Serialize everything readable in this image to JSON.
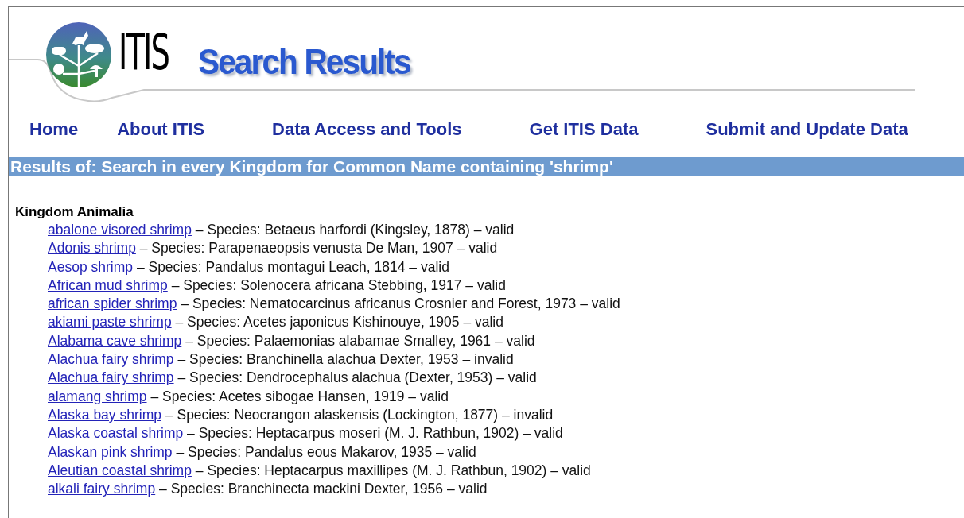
{
  "header": {
    "logo_text": "ITIS",
    "title": "Search Results"
  },
  "nav": [
    "Home",
    "About ITIS",
    "Data Access and Tools",
    "Get ITIS Data",
    "Submit and Update Data"
  ],
  "banner": "Results of: Search in every Kingdom for Common Name containing 'shrimp'",
  "kingdom": "Kingdom Animalia",
  "results": [
    {
      "name": "abalone visored shrimp",
      "detail": "– Species: Betaeus harfordi (Kingsley, 1878) – valid"
    },
    {
      "name": "Adonis shrimp",
      "detail": "– Species: Parapenaeopsis venusta De Man, 1907 – valid"
    },
    {
      "name": "Aesop shrimp",
      "detail": "– Species: Pandalus montagui Leach, 1814 – valid"
    },
    {
      "name": "African mud shrimp",
      "detail": "– Species: Solenocera africana Stebbing, 1917 – valid"
    },
    {
      "name": "african spider shrimp",
      "detail": "– Species: Nematocarcinus africanus Crosnier and Forest, 1973 – valid"
    },
    {
      "name": "akiami paste shrimp",
      "detail": "– Species: Acetes japonicus Kishinouye, 1905 – valid"
    },
    {
      "name": "Alabama cave shrimp",
      "detail": "– Species: Palaemonias alabamae Smalley, 1961 – valid"
    },
    {
      "name": "Alachua fairy shrimp",
      "detail": "– Species: Branchinella alachua Dexter, 1953 – invalid"
    },
    {
      "name": "Alachua fairy shrimp",
      "detail": "– Species: Dendrocephalus alachua (Dexter, 1953) – valid"
    },
    {
      "name": "alamang shrimp",
      "detail": "– Species: Acetes sibogae Hansen, 1919 – valid"
    },
    {
      "name": "Alaska bay shrimp",
      "detail": "– Species: Neocrangon alaskensis (Lockington, 1877) – invalid"
    },
    {
      "name": "Alaska coastal shrimp",
      "detail": "– Species: Heptacarpus moseri (M. J. Rathbun, 1902) – valid"
    },
    {
      "name": "Alaskan pink shrimp",
      "detail": "– Species: Pandalus eous Makarov, 1935 – valid"
    },
    {
      "name": "Aleutian coastal shrimp",
      "detail": "– Species: Heptacarpus maxillipes (M. J. Rathbun, 1902) – valid"
    },
    {
      "name": "alkali fairy shrimp",
      "detail": "– Species: Branchinecta mackini Dexter, 1956 – valid"
    }
  ]
}
